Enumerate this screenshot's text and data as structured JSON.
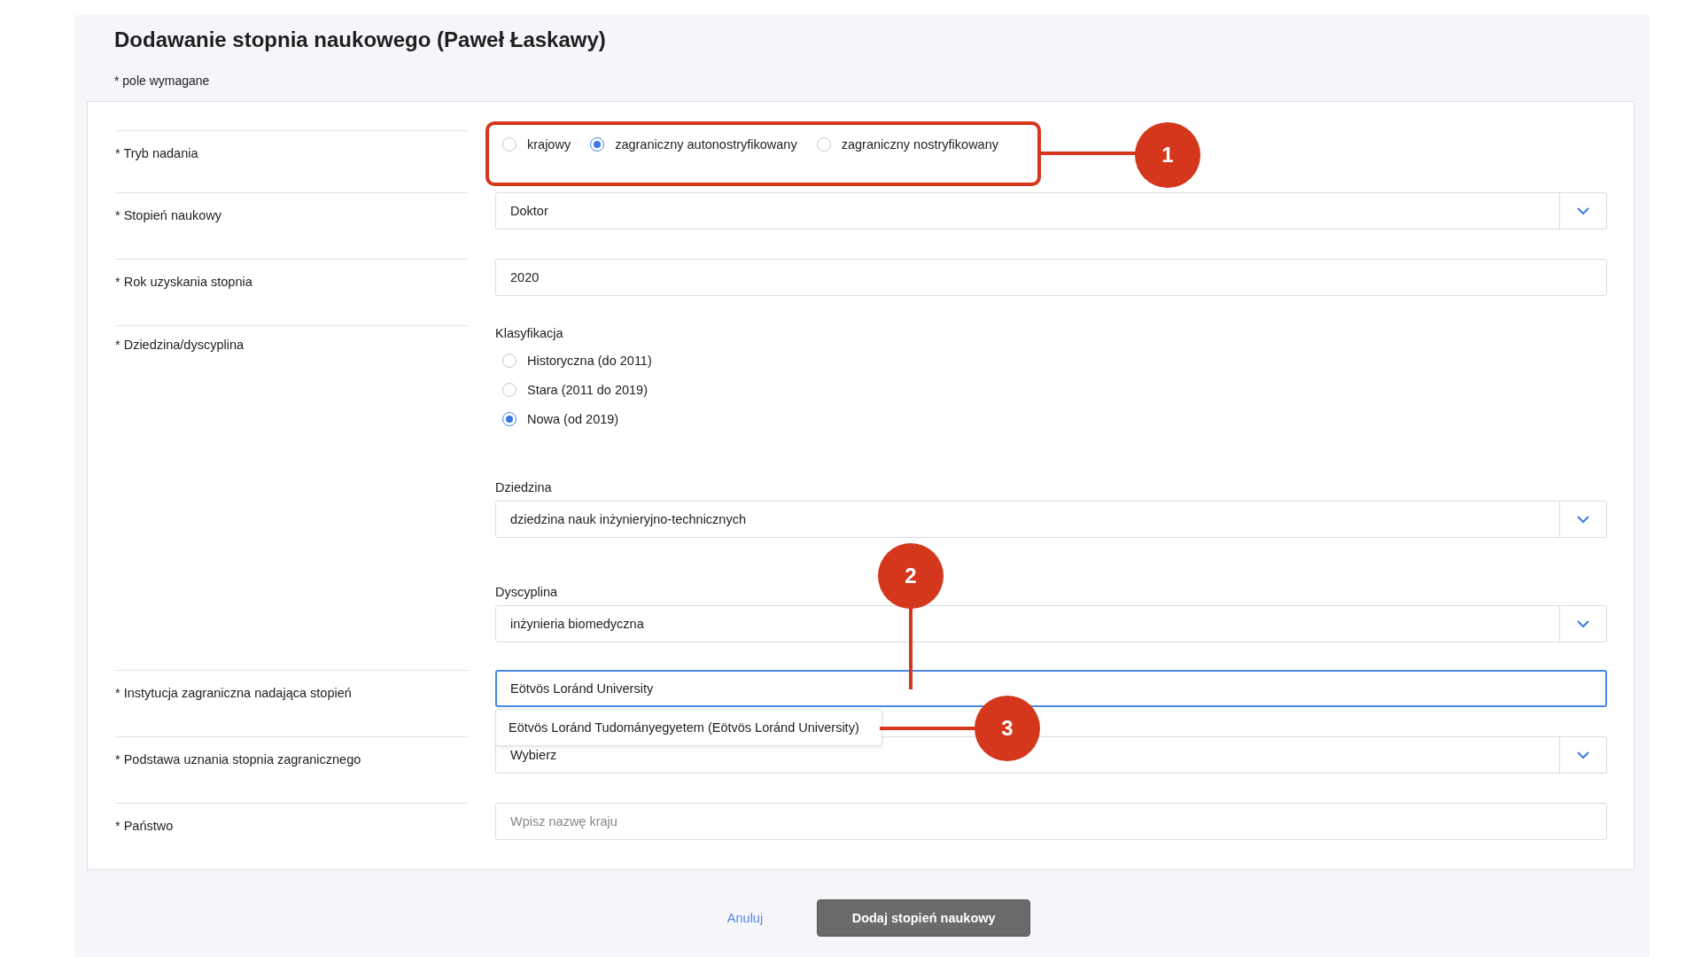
{
  "title": "Dodawanie stopnia naukowego (Paweł Łaskawy)",
  "required_note": "* pole wymagane",
  "fields": [
    {
      "kind": "radio",
      "label": "* Tryb nadania",
      "options": [
        {
          "label": "krajowy",
          "selected": false
        },
        {
          "label": "zagraniczny autonostryfikowany",
          "selected": true
        },
        {
          "label": "zagraniczny nostryfikowany",
          "selected": false
        }
      ]
    },
    {
      "kind": "select",
      "label": "* Stopień naukowy",
      "value": "Doktor"
    },
    {
      "kind": "text",
      "label": "* Rok uzyskania stopnia",
      "value": "2020"
    },
    {
      "kind": "discipline",
      "label": "* Dziedzina/dyscyplina",
      "classification": {
        "label": "Klasyfikacja",
        "options": [
          {
            "label": "Historyczna (do 2011)",
            "selected": false
          },
          {
            "label": "Stara (2011 do 2019)",
            "selected": false
          },
          {
            "label": "Nowa (od 2019)",
            "selected": true
          }
        ]
      },
      "selects": [
        {
          "label": "Dziedzina",
          "value": "dziedzina nauk inżynieryjno-technicznych"
        },
        {
          "label": "Dyscyplina",
          "value": "inżynieria biomedyczna"
        }
      ]
    },
    {
      "kind": "autocomplete",
      "label": "* Instytucja zagraniczna nadająca stopień",
      "value": "Eötvös Loránd University",
      "focused": true,
      "suggestions": [
        "Eötvös Loránd Tudományegyetem (Eötvös Loránd University)"
      ]
    },
    {
      "kind": "select",
      "label": "* Podstawa uznania stopnia zagranicznego",
      "value": "Wybierz"
    },
    {
      "kind": "text",
      "label": "* Państwo",
      "placeholder": "Wpisz nazwę kraju"
    }
  ],
  "buttons": {
    "cancel": "Anuluj",
    "submit": "Dodaj stopień naukowy"
  },
  "annotations": [
    {
      "number": "1"
    },
    {
      "number": "2"
    },
    {
      "number": "3"
    }
  ]
}
